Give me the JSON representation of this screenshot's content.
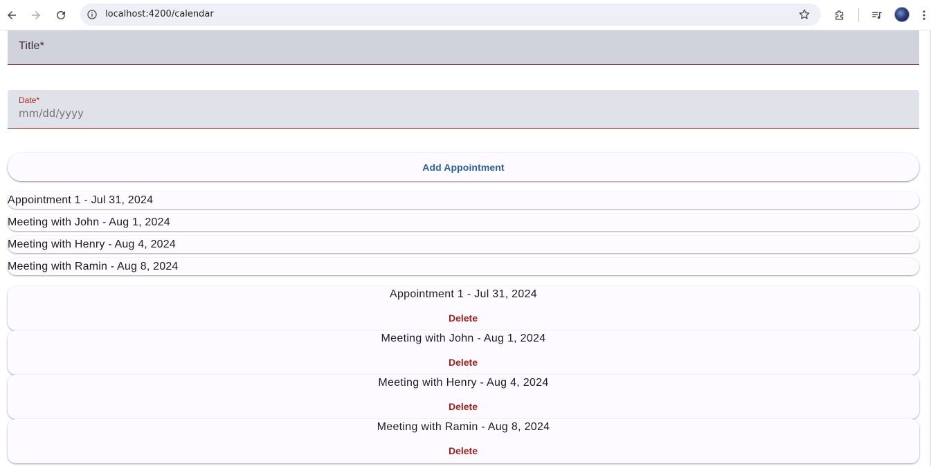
{
  "browser": {
    "url": "localhost:4200/calendar",
    "icons": [
      "back-arrow-icon",
      "forward-arrow-icon",
      "reload-icon",
      "info-icon",
      "star-icon",
      "extensions-icon",
      "media-queue-icon",
      "profile-avatar",
      "more-vert-icon"
    ]
  },
  "form": {
    "title_label": "Title*",
    "date_label": "Date*",
    "date_placeholder": "mm/dd/yyyy",
    "add_button_label": "Add Appointment"
  },
  "appointments_list": [
    {
      "label": "Appointment 1 - Jul 31, 2024"
    },
    {
      "label": "Meeting with John - Aug 1, 2024"
    },
    {
      "label": "Meeting with Henry - Aug 4, 2024"
    },
    {
      "label": "Meeting with Ramin - Aug 8, 2024"
    }
  ],
  "appointment_cards": [
    {
      "title": "Appointment 1 - Jul 31, 2024",
      "delete_label": "Delete"
    },
    {
      "title": "Meeting with John - Aug 1, 2024",
      "delete_label": "Delete"
    },
    {
      "title": "Meeting with Henry - Aug 4, 2024",
      "delete_label": "Delete"
    },
    {
      "title": "Meeting with Ramin - Aug 8, 2024",
      "delete_label": "Delete"
    }
  ],
  "colors": {
    "accent": "#2c5f9e",
    "error": "#b3261e",
    "delete": "#a1211a",
    "field_bg": "#e0e2ea"
  }
}
